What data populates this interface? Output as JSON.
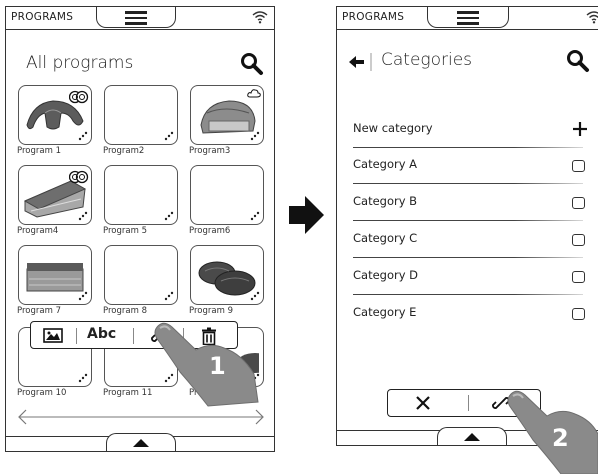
{
  "left": {
    "topbar_label": "PROGRAMS",
    "title": "All programs",
    "programs": [
      {
        "label": "Program 1",
        "image": "croissant",
        "flags": true,
        "cloud": false
      },
      {
        "label": "Program2",
        "image": "none",
        "flags": false,
        "cloud": false
      },
      {
        "label": "Program3",
        "image": "bread-loaf",
        "flags": false,
        "cloud": true
      },
      {
        "label": "Program4",
        "image": "cake-slice",
        "flags": true,
        "cloud": false
      },
      {
        "label": "Program 5",
        "image": "none",
        "flags": false,
        "cloud": false
      },
      {
        "label": "Program6",
        "image": "none",
        "flags": false,
        "cloud": false
      },
      {
        "label": "Program 7",
        "image": "cake-square",
        "flags": false,
        "cloud": false
      },
      {
        "label": "Program 8",
        "image": "none",
        "flags": false,
        "cloud": false
      },
      {
        "label": "Program 9",
        "image": "burger-patties",
        "flags": false,
        "cloud": false
      },
      {
        "label": "Program 10",
        "image": "none",
        "flags": false,
        "cloud": false
      },
      {
        "label": "Program 11",
        "image": "none",
        "flags": false,
        "cloud": false
      },
      {
        "label": "Prog",
        "image": "partial",
        "flags": false,
        "cloud": false
      }
    ],
    "toolbar": {
      "text_label": "Abc",
      "icons": [
        "image-icon",
        "text-icon",
        "link-icon",
        "trash-icon"
      ]
    },
    "step_badge": "1"
  },
  "right": {
    "topbar_label": "PROGRAMS",
    "title": "Categories",
    "new_category": "New category",
    "categories": [
      "Category A",
      "Category B",
      "Category C",
      "Category D",
      "Category E"
    ],
    "actions": [
      "close-icon",
      "link-icon"
    ],
    "step_badge": "2"
  },
  "icons": {
    "arrow": "right-arrow-icon",
    "search": "search-icon",
    "menu": "hamburger-icon",
    "wifi": "wifi-icon",
    "back": "back-arrow-icon",
    "add": "plus-icon"
  }
}
